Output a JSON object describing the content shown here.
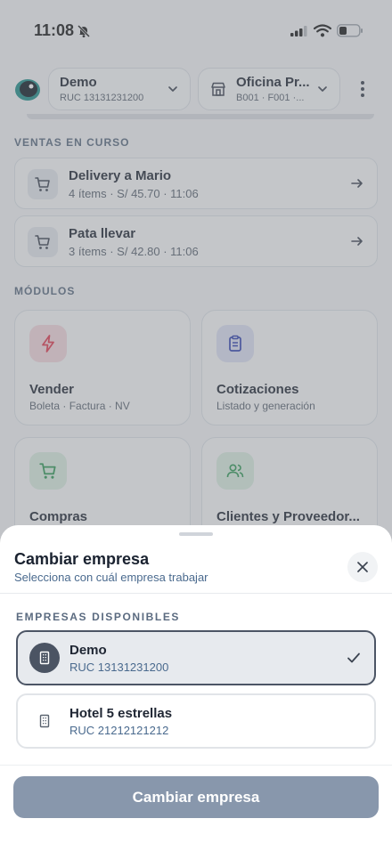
{
  "status_bar": {
    "time": "11:08"
  },
  "header": {
    "company": {
      "name": "Demo",
      "ruc": "RUC 13131231200"
    },
    "office": {
      "name": "Oficina Pr...",
      "series": "B001 · F001 ·..."
    }
  },
  "sales_in_progress": {
    "title": "VENTAS EN CURSO",
    "items": [
      {
        "name": "Delivery a Mario",
        "meta": "4 ítems · S/ 45.70 · 11:06"
      },
      {
        "name": "Pata llevar",
        "meta": "3 ítems · S/ 42.80 · 11:06"
      }
    ]
  },
  "modules": {
    "title": "MÓDULOS",
    "items": [
      {
        "title": "Vender",
        "subtitle": "Boleta · Factura · NV",
        "icon": "bolt-icon",
        "color": "#e3394f",
        "bg": "#f6dadf"
      },
      {
        "title": "Cotizaciones",
        "subtitle": "Listado y generación",
        "icon": "clipboard-icon",
        "color": "#2d3fb0",
        "bg": "#dfe2f4"
      },
      {
        "title": "Compras",
        "subtitle": "",
        "icon": "cart-icon",
        "color": "#2f9a55",
        "bg": "#dcefe2"
      },
      {
        "title": "Clientes y Proveedor...",
        "subtitle": "",
        "icon": "users-icon",
        "color": "#2f9a55",
        "bg": "#dcefe2"
      }
    ]
  },
  "sheet": {
    "title": "Cambiar empresa",
    "subtitle": "Selecciona con cuál empresa trabajar",
    "section_label": "EMPRESAS DISPONIBLES",
    "companies": [
      {
        "name": "Demo",
        "ruc": "RUC 13131231200",
        "selected": true
      },
      {
        "name": "Hotel 5 estrellas",
        "ruc": "RUC 21212121212",
        "selected": false
      }
    ],
    "button_label": "Cambiar empresa"
  },
  "colors": {
    "accent": "#4b5463",
    "button": "#8897ac",
    "subtitle": "#4a6a8e"
  }
}
